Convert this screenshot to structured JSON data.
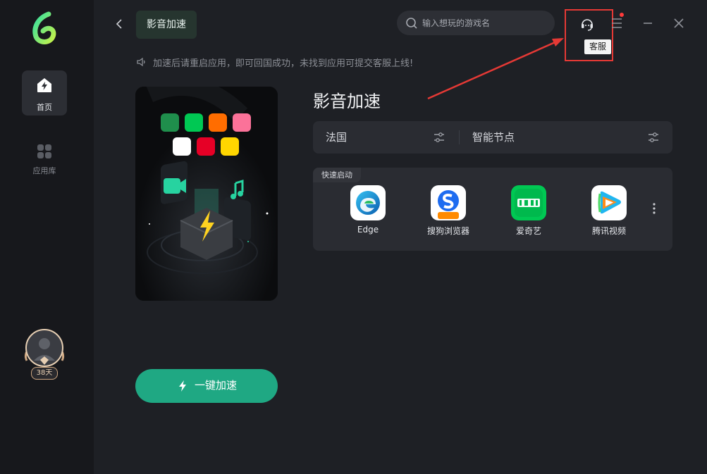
{
  "sidebar": {
    "items": [
      {
        "label": "首页",
        "icon": "home-bolt-icon",
        "active": true
      },
      {
        "label": "应用库",
        "icon": "grid-apps-icon",
        "active": false
      }
    ],
    "membership": {
      "days_label": "38天"
    }
  },
  "header": {
    "tab_label": "影音加速",
    "search": {
      "placeholder": "输入想玩的游戏名"
    },
    "support": {
      "icon": "headset-icon",
      "tooltip": "客服"
    },
    "menu_icon": "menu-icon"
  },
  "notice": {
    "text": "加速后请重启应用，即可回国成功，未找到应用可提交客服上线!"
  },
  "main": {
    "section_title": "影音加速",
    "region": {
      "country": "法国",
      "node": "智能节点"
    },
    "quick_launch": {
      "label": "快速启动",
      "apps": [
        {
          "name": "Edge",
          "icon": "edge-icon"
        },
        {
          "name": "搜狗浏览器",
          "icon": "sogou-browser-icon",
          "badge": "领现金"
        },
        {
          "name": "爱奇艺",
          "icon": "iqiyi-icon"
        },
        {
          "name": "腾讯视频",
          "icon": "tencent-video-icon"
        }
      ]
    },
    "banner": {
      "app_badges": [
        {
          "name": "tencent-video",
          "color": "#4cd964"
        },
        {
          "name": "iqiyi",
          "color": "#00c853"
        },
        {
          "name": "mgtv",
          "color": "#ff6d00"
        },
        {
          "name": "bilibili",
          "color": "#fb7299"
        },
        {
          "name": "youku",
          "color": "#ffffff"
        },
        {
          "name": "netease-music",
          "color": "#e60026"
        },
        {
          "name": "kuwo",
          "color": "#ffd600"
        }
      ]
    },
    "cta": {
      "label": "一键加速"
    }
  },
  "colors": {
    "accent": "#1fa883",
    "highlight_box": "#e53935"
  }
}
